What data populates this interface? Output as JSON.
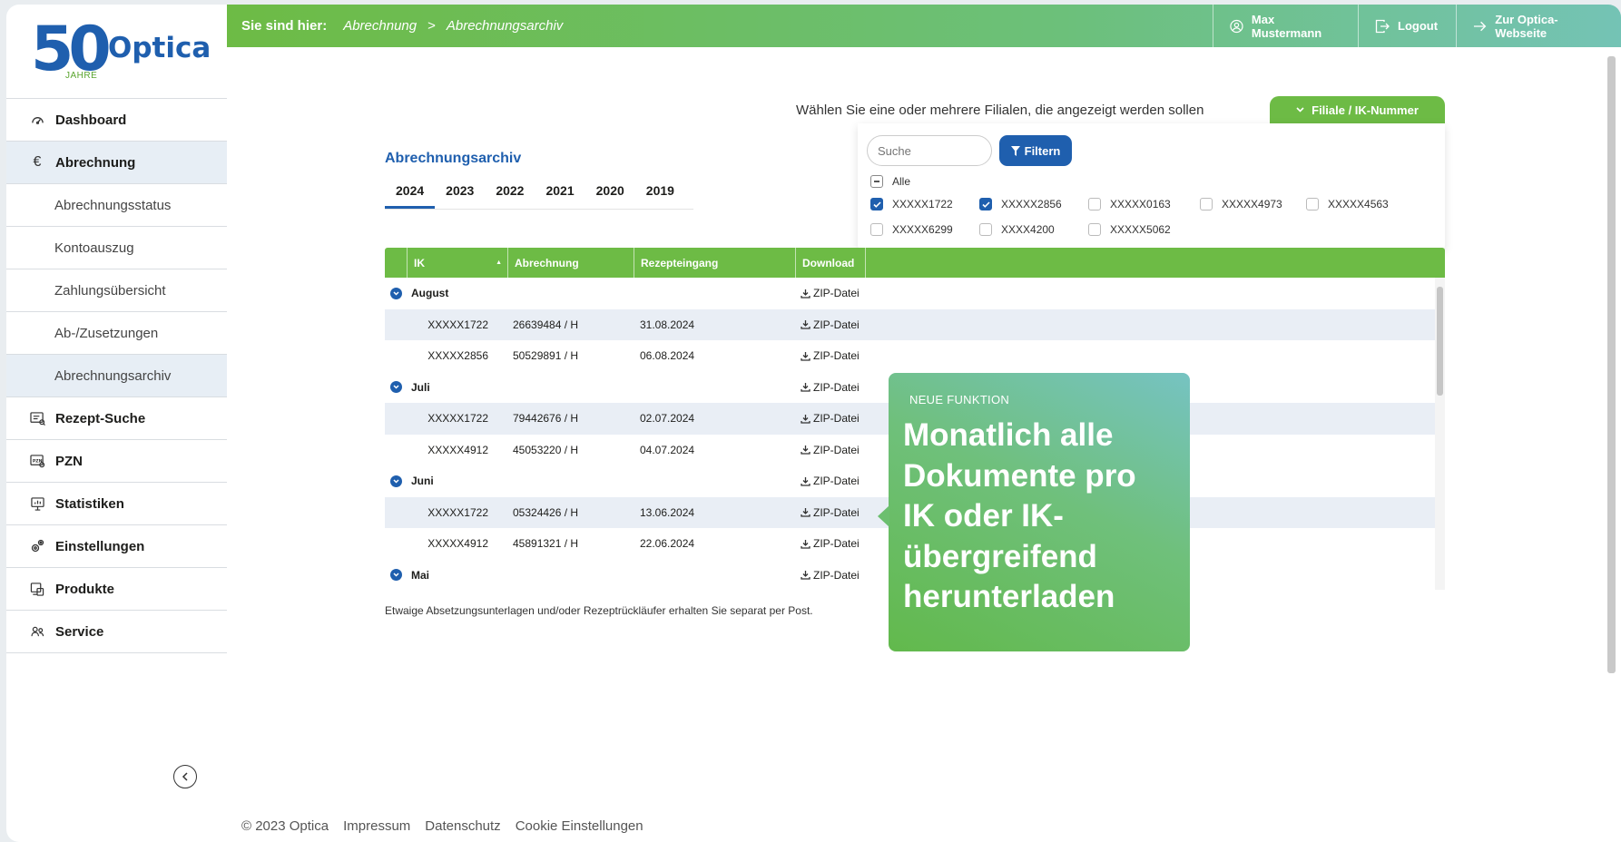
{
  "brand": {
    "logo_number": "50",
    "logo_sub": "JAHRE",
    "logo_name": "Optica"
  },
  "sidebar": {
    "items": [
      {
        "label": "Dashboard",
        "icon": "dashboard-icon"
      },
      {
        "label": "Abrechnung",
        "icon": "euro-icon"
      },
      {
        "label": "Abrechnungsstatus"
      },
      {
        "label": "Kontoauszug"
      },
      {
        "label": "Zahlungsübersicht"
      },
      {
        "label": "Ab-/Zusetzungen"
      },
      {
        "label": "Abrechnungsarchiv"
      },
      {
        "label": "Rezept-Suche",
        "icon": "prescription-search-icon"
      },
      {
        "label": "PZN",
        "icon": "pzn-icon"
      },
      {
        "label": "Statistiken",
        "icon": "statistics-icon"
      },
      {
        "label": "Einstellungen",
        "icon": "gear-icon"
      },
      {
        "label": "Produkte",
        "icon": "products-icon"
      },
      {
        "label": "Service",
        "icon": "service-icon"
      }
    ]
  },
  "topbar": {
    "breadcrumb_label": "Sie sind hier:",
    "crumbs": [
      "Abrechnung",
      "Abrechnungsarchiv"
    ],
    "crumb_separator": ">",
    "user": "Max Mustermann",
    "logout": "Logout",
    "website": "Zur Optica-Webseite"
  },
  "filter": {
    "prompt": "Wählen Sie eine oder mehrere Filialen, die angezeigt werden sollen",
    "button": "Filiale / IK-Nummer",
    "search_placeholder": "Suche",
    "filter_button": "Filtern",
    "all_label": "Alle",
    "options": [
      {
        "label": "XXXXX1722",
        "checked": true
      },
      {
        "label": "XXXXX2856",
        "checked": true
      },
      {
        "label": "XXXXX0163",
        "checked": false
      },
      {
        "label": "XXXXX4973",
        "checked": false
      },
      {
        "label": "XXXXX4563",
        "checked": false
      },
      {
        "label": "XXXXX6299",
        "checked": false
      },
      {
        "label": "XXXX4200",
        "checked": false
      },
      {
        "label": "XXXXX5062",
        "checked": false
      }
    ]
  },
  "page": {
    "title": "Abrechnungsarchiv",
    "years": [
      "2024",
      "2023",
      "2022",
      "2021",
      "2020",
      "2019"
    ],
    "active_year": "2024",
    "note": "Etwaige Absetzungsunterlagen und/oder Rezeptrückläufer erhalten Sie separat per Post."
  },
  "table": {
    "headers": [
      "IK",
      "Abrechnung",
      "Rezepteingang",
      "Download"
    ],
    "download_label": "ZIP-Datei",
    "rows": [
      {
        "type": "group",
        "name": "August"
      },
      {
        "type": "row",
        "ik": "XXXXX1722",
        "abrechnung": "26639484 / H",
        "eingang": "31.08.2024"
      },
      {
        "type": "row",
        "ik": "XXXXX2856",
        "abrechnung": "50529891 / H",
        "eingang": "06.08.2024"
      },
      {
        "type": "group",
        "name": "Juli"
      },
      {
        "type": "row",
        "ik": "XXXXX1722",
        "abrechnung": "79442676 / H",
        "eingang": "02.07.2024"
      },
      {
        "type": "row",
        "ik": "XXXXX4912",
        "abrechnung": "45053220 / H",
        "eingang": "04.07.2024"
      },
      {
        "type": "group",
        "name": "Juni"
      },
      {
        "type": "row",
        "ik": "XXXXX1722",
        "abrechnung": "05324426 / H",
        "eingang": "13.06.2024"
      },
      {
        "type": "row",
        "ik": "XXXXX4912",
        "abrechnung": "45891321 / H",
        "eingang": "22.06.2024"
      },
      {
        "type": "group",
        "name": "Mai"
      }
    ]
  },
  "promo": {
    "kicker": "NEUE FUNKTION",
    "headline_lines": [
      "Monatlich alle",
      "Dokumente pro",
      "IK oder IK-",
      "übergreifend",
      "herunterladen"
    ]
  },
  "footer": {
    "copyright": "© 2023 Optica",
    "links": [
      "Impressum",
      "Datenschutz",
      "Cookie Einstellungen"
    ]
  },
  "colors": {
    "primary_blue": "#1f5fae",
    "primary_green": "#6dbb45",
    "row_highlight": "#e9eef5"
  }
}
